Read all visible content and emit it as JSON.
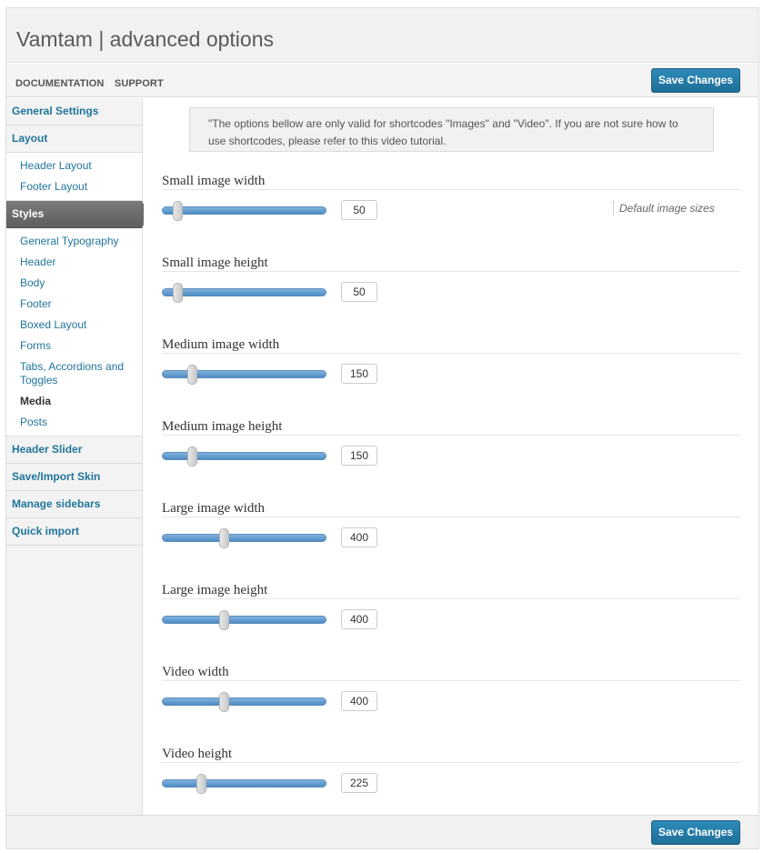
{
  "title": "Vamtam | advanced options",
  "toolbar": {
    "links": [
      "DOCUMENTATION",
      "SUPPORT"
    ],
    "save_label": "Save Changes"
  },
  "footer": {
    "save_label": "Save Changes"
  },
  "sidebar": {
    "groups": [
      {
        "label": "General Settings"
      },
      {
        "label": "Layout",
        "items": [
          "Header Layout",
          "Footer Layout"
        ]
      },
      {
        "label": "Styles",
        "items": [
          "General Typography",
          "Header",
          "Body",
          "Footer",
          "Boxed Layout",
          "Forms",
          "Tabs, Accordions and Toggles",
          "Media",
          "Posts"
        ]
      },
      {
        "label": "Header Slider"
      },
      {
        "label": "Save/Import Skin"
      },
      {
        "label": "Manage sidebars"
      },
      {
        "label": "Quick import"
      }
    ],
    "active_group": "Styles",
    "current_item": "Media"
  },
  "notice": "\"The options bellow are only valid for shortcodes \"Images\" and \"Video\". If you are not sure how to use shortcodes, please refer to this video tutorial.",
  "options": [
    {
      "label": "Small image width",
      "value": "50",
      "level": 0.06,
      "desc": "Default image sizes"
    },
    {
      "label": "Small image height",
      "value": "50",
      "level": 0.06
    },
    {
      "label": "Medium image width",
      "value": "150",
      "level": 0.15
    },
    {
      "label": "Medium image height",
      "value": "150",
      "level": 0.15
    },
    {
      "label": "Large image width",
      "value": "400",
      "level": 0.36
    },
    {
      "label": "Large image height",
      "value": "400",
      "level": 0.36
    },
    {
      "label": "Video width",
      "value": "400",
      "level": 0.36
    },
    {
      "label": "Video height",
      "value": "225",
      "level": 0.21
    }
  ],
  "colors": {
    "link": "#21759b",
    "button": "#21759b",
    "slider": "#4f8cc3"
  }
}
